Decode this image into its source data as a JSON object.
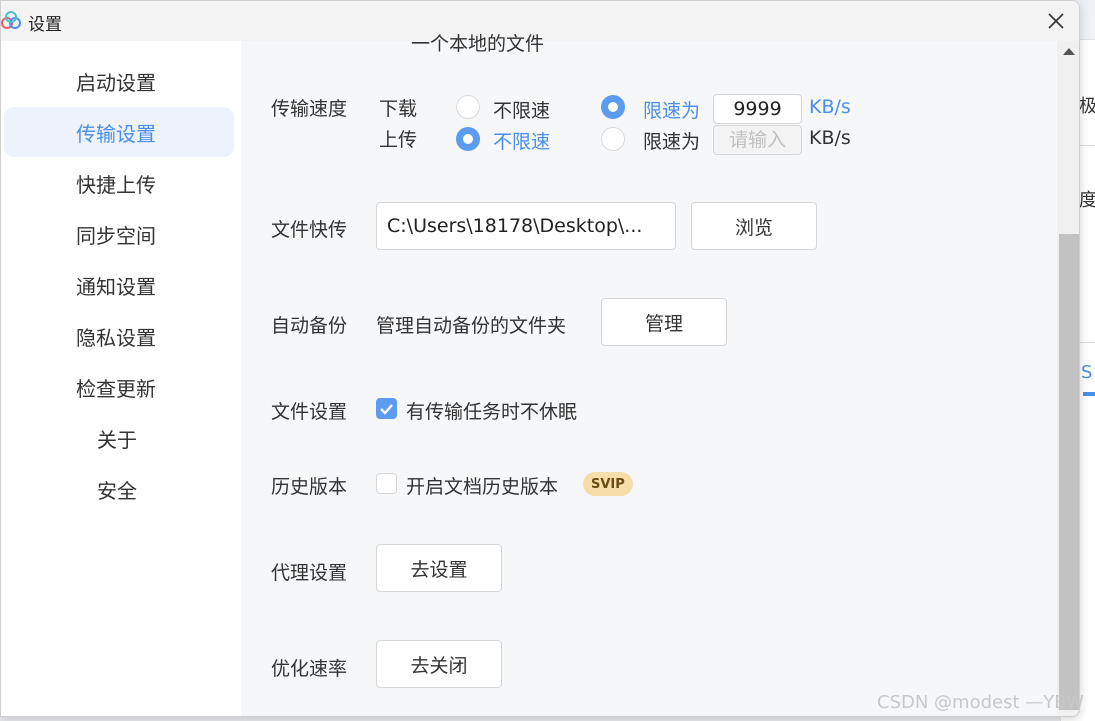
{
  "window": {
    "title": "设置",
    "close_symbol": "✕"
  },
  "sidebar": {
    "items": [
      {
        "label": "启动设置"
      },
      {
        "label": "传输设置",
        "active": true
      },
      {
        "label": "快捷上传"
      },
      {
        "label": "同步空间"
      },
      {
        "label": "通知设置"
      },
      {
        "label": "隐私设置"
      },
      {
        "label": "检查更新"
      },
      {
        "label": "关于"
      },
      {
        "label": "安全"
      }
    ]
  },
  "content": {
    "cut_off_text": "一个本地的文件",
    "speed": {
      "label": "传输速度",
      "download_label": "下载",
      "upload_label": "上传",
      "unlimited": "不限速",
      "limit_to": "限速为",
      "unit": "KB/s",
      "download_value": "9999",
      "upload_placeholder": "请输入"
    },
    "quick_transfer": {
      "label": "文件快传",
      "path": "C:\\Users\\18178\\Desktop\\...",
      "browse": "浏览"
    },
    "auto_backup": {
      "label": "自动备份",
      "description": "管理自动备份的文件夹",
      "manage": "管理"
    },
    "file_settings": {
      "label": "文件设置",
      "option": "有传输任务时不休眠",
      "checked": true
    },
    "history": {
      "label": "历史版本",
      "option": "开启文档历史版本",
      "badge": "SVIP",
      "checked": false
    },
    "proxy": {
      "label": "代理设置",
      "button": "去设置"
    },
    "optimize": {
      "label": "优化速率",
      "button": "去关闭"
    }
  },
  "background_window": {
    "text1": "极",
    "text2": "度:",
    "text3": "S"
  },
  "watermark": "CSDN @modest —YBW",
  "colors": {
    "accent": "#4a8fe7",
    "radio_on": "#5b9cf0",
    "active_bg": "#eef3fb",
    "badge_bg": "#f5deaa"
  }
}
